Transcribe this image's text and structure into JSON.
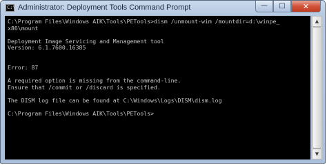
{
  "window": {
    "title": "Administrator: Deployment Tools Command Prompt",
    "app_icon_glyph": "C:\\",
    "buttons": {
      "minimize": "—",
      "maximize": "□",
      "close": "✕"
    }
  },
  "console": {
    "lines": [
      "C:\\Program Files\\Windows AIK\\Tools\\PETools>dism /unmount-wim /mountdir=d:\\winpe_",
      "x86\\mount",
      "",
      "Deployment Image Servicing and Management tool",
      "Version: 6.1.7600.16385",
      "",
      "",
      "Error: 87",
      "",
      "A required option is missing from the command-line.",
      "Ensure that /commit or /discard is specified.",
      "",
      "The DISM log file can be found at C:\\Windows\\Logs\\DISM\\dism.log",
      "",
      "C:\\Program Files\\Windows AIK\\Tools\\PETools>"
    ],
    "text_color": "#c8c8c8",
    "background_color": "#000000"
  },
  "scrollbar": {
    "up_arrow": "▲",
    "down_arrow": "▼",
    "thumb_start_fraction": 0.0,
    "thumb_size_fraction": 1.0
  }
}
